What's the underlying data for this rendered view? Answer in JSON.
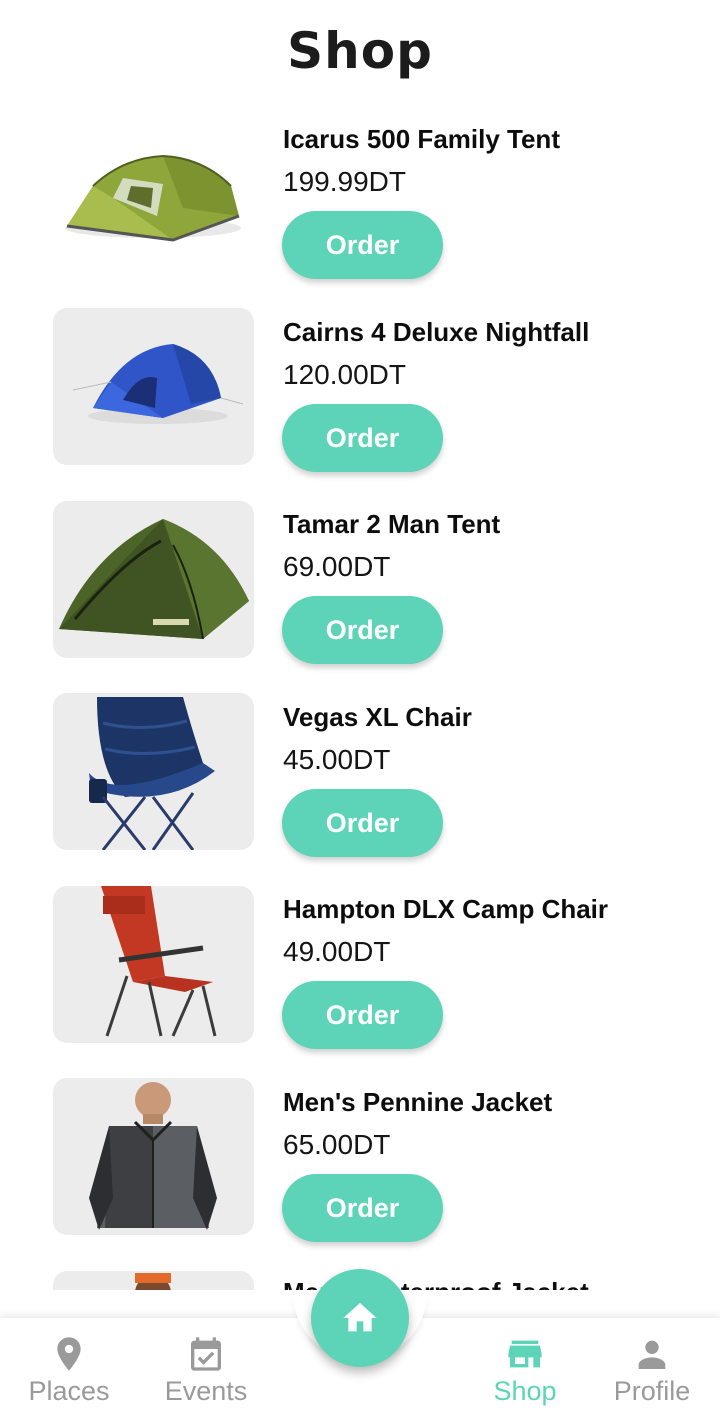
{
  "header": {
    "title": "Shop"
  },
  "products": [
    {
      "name": "Icarus 500 Family Tent",
      "price": "199.99DT",
      "order_label": "Order",
      "image": "tent-green-tunnel"
    },
    {
      "name": "Cairns 4 Deluxe Nightfall",
      "price": "120.00DT",
      "order_label": "Order",
      "image": "tent-blue-dome"
    },
    {
      "name": "Tamar 2 Man Tent",
      "price": "69.00DT",
      "order_label": "Order",
      "image": "tent-green-dome"
    },
    {
      "name": "Vegas XL Chair",
      "price": "45.00DT",
      "order_label": "Order",
      "image": "chair-navy"
    },
    {
      "name": "Hampton DLX Camp Chair",
      "price": "49.00DT",
      "order_label": "Order",
      "image": "chair-red"
    },
    {
      "name": "Men's Pennine Jacket",
      "price": "65.00DT",
      "order_label": "Order",
      "image": "jacket-grey"
    },
    {
      "name": "Men's Waterproof Jacket",
      "price": "",
      "order_label": "",
      "image": "jacket-partial"
    }
  ],
  "nav": {
    "items": [
      {
        "label": "Places",
        "icon": "location-pin-icon"
      },
      {
        "label": "Events",
        "icon": "calendar-check-icon"
      },
      {
        "label": "Shop",
        "icon": "store-icon",
        "active": true
      },
      {
        "label": "Profile",
        "icon": "person-icon"
      }
    ],
    "fab_icon": "home-icon"
  },
  "colors": {
    "accent": "#5dd4b8",
    "inactive": "#9a9a9a",
    "thumb_bg": "#ececec"
  }
}
